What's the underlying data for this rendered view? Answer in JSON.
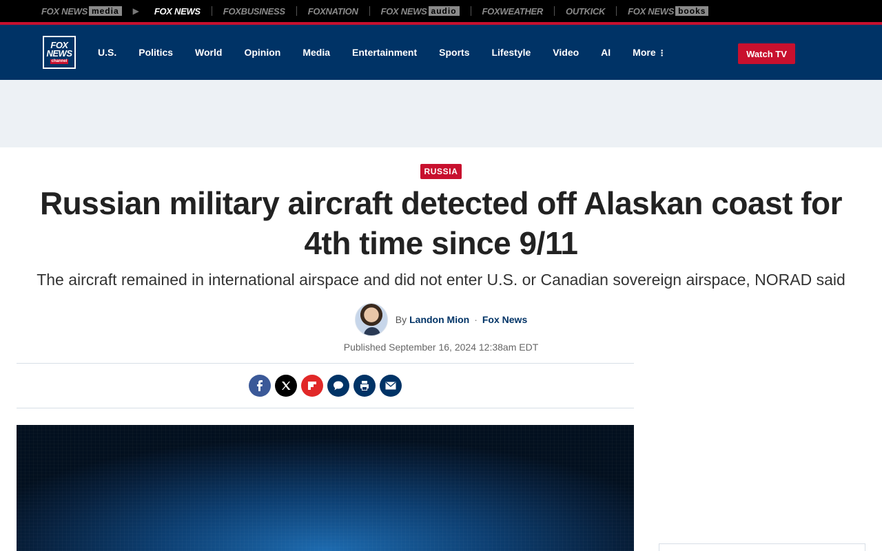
{
  "brand_bar": {
    "items": [
      {
        "name": "FOX NEWS",
        "suffix": "media"
      },
      {
        "name": "FOX NEWS",
        "suffix": ""
      },
      {
        "name": "FOX",
        "suffix": "BUSINESS"
      },
      {
        "name": "FOX",
        "suffix": "NATION"
      },
      {
        "name": "FOX NEWS",
        "suffix": "audio"
      },
      {
        "name": "FOX",
        "suffix": "WEATHER"
      },
      {
        "name": "OUTKICK",
        "suffix": ""
      },
      {
        "name": "FOX NEWS",
        "suffix": "books"
      }
    ]
  },
  "logo": {
    "line1": "FOX",
    "line2": "NEWS",
    "line3": "channel"
  },
  "nav": {
    "items": [
      "U.S.",
      "Politics",
      "World",
      "Opinion",
      "Media",
      "Entertainment",
      "Sports",
      "Lifestyle",
      "Video",
      "AI",
      "More"
    ],
    "more_icon": "⋮",
    "watch_tv": "Watch TV"
  },
  "article": {
    "eyebrow": "RUSSIA",
    "headline": "Russian military aircraft detected off Alaskan coast for 4th time since 9/11",
    "subhead": "The aircraft remained in international airspace and did not enter U.S. or Canadian sovereign airspace, NORAD said",
    "by_label": "By",
    "author": "Landon Mion",
    "separator": "·",
    "outlet": "Fox News",
    "published": "Published September 16, 2024 12:38am EDT"
  },
  "share": {
    "icons": [
      "facebook-icon",
      "x-icon",
      "flipboard-icon",
      "comment-icon",
      "print-icon",
      "email-icon"
    ]
  },
  "colors": {
    "brand_navy": "#003366",
    "brand_red": "#c8102e"
  }
}
